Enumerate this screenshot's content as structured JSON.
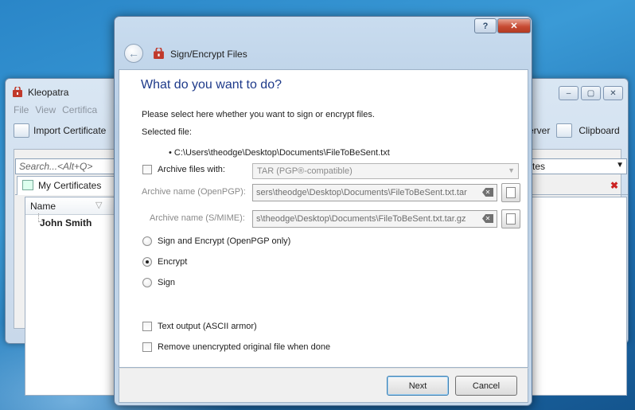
{
  "kleopatra": {
    "title": "Kleopatra",
    "menu": [
      "File",
      "View",
      "Certifica"
    ],
    "toolbar": {
      "import_label": "Import Certificate",
      "server_label": "erver",
      "clipboard_label": "Clipboard"
    },
    "search_placeholder": "Search...<Alt+Q>",
    "filter_value": "tes",
    "tab_label": "My Certificates",
    "column_name": "Name",
    "rows": [
      "John Smith"
    ],
    "window_buttons": {
      "minimize": "–",
      "maximize": "▢",
      "close": "✕"
    }
  },
  "dialog": {
    "title": "Sign/Encrypt Files",
    "help_label": "?",
    "close_label": "✕",
    "heading": "What do you want to do?",
    "instruction": "Please select here whether you want to sign or encrypt files.",
    "selected_file_label": "Selected file:",
    "selected_file": "• C:\\Users\\theodge\\Desktop\\Documents\\FileToBeSent.txt",
    "archive_label": "Archive files with:",
    "archive_format": "TAR (PGP®-compatible)",
    "archive_openpgp_label": "Archive name (OpenPGP):",
    "archive_openpgp_value": "sers\\theodge\\Desktop\\Documents\\FileToBeSent.txt.tar",
    "archive_smime_label": "Archive name (S/MIME):",
    "archive_smime_value": "s\\theodge\\Desktop\\Documents\\FileToBeSent.txt.tar.gz",
    "options": [
      {
        "label": "Sign and Encrypt (OpenPGP only)",
        "checked": false
      },
      {
        "label": "Encrypt",
        "checked": true
      },
      {
        "label": "Sign",
        "checked": false
      }
    ],
    "text_output_label": "Text output (ASCII armor)",
    "remove_label": "Remove unencrypted original file when done",
    "next_label": "Next",
    "cancel_label": "Cancel"
  },
  "colors": {
    "heading": "#1e3a8a",
    "desktop": "#2a86c8",
    "close_button": "#c74b33"
  }
}
